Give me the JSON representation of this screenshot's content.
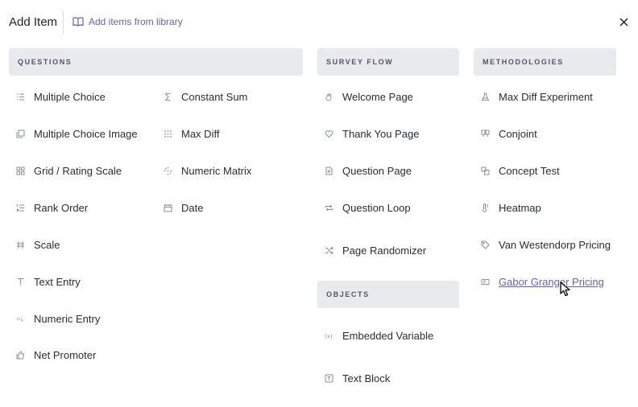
{
  "header": {
    "title": "Add Item",
    "library_link": "Add items from library"
  },
  "sections": {
    "questions": {
      "heading": "QUESTIONS",
      "col1": [
        {
          "label": "Multiple Choice",
          "icon": "list-icon"
        },
        {
          "label": "Multiple Choice Image",
          "icon": "image-stack-icon"
        },
        {
          "label": "Grid / Rating Scale",
          "icon": "grid-icon"
        },
        {
          "label": "Rank Order",
          "icon": "ordered-list-icon"
        },
        {
          "label": "Scale",
          "icon": "scale-icon"
        },
        {
          "label": "Text Entry",
          "icon": "text-icon"
        },
        {
          "label": "Numeric Entry",
          "icon": "numbers-icon"
        },
        {
          "label": "Net Promoter",
          "icon": "thumbs-up-icon"
        }
      ],
      "col2": [
        {
          "label": "Constant Sum",
          "icon": "sigma-icon"
        },
        {
          "label": "Max Diff",
          "icon": "dots-grid-icon"
        },
        {
          "label": "Numeric Matrix",
          "icon": "dots-circle-icon"
        },
        {
          "label": "Date",
          "icon": "calendar-icon"
        }
      ]
    },
    "survey_flow": {
      "heading": "SURVEY FLOW",
      "items": [
        {
          "label": "Welcome Page",
          "icon": "hand-icon"
        },
        {
          "label": "Thank You Page",
          "icon": "heart-icon"
        },
        {
          "label": "Question Page",
          "icon": "page-icon"
        },
        {
          "label": "Question Loop",
          "icon": "loop-icon"
        },
        {
          "label": "Page Randomizer",
          "icon": "shuffle-icon"
        }
      ]
    },
    "objects": {
      "heading": "OBJECTS",
      "items": [
        {
          "label": "Embedded Variable",
          "icon": "variable-icon"
        },
        {
          "label": "Text Block",
          "icon": "text-block-icon"
        }
      ]
    },
    "methodologies": {
      "heading": "METHODOLOGIES",
      "items": [
        {
          "label": "Max Diff Experiment",
          "icon": "flask-icon"
        },
        {
          "label": "Conjoint",
          "icon": "conjoint-icon"
        },
        {
          "label": "Concept Test",
          "icon": "concept-icon"
        },
        {
          "label": "Heatmap",
          "icon": "thermometer-icon"
        },
        {
          "label": "Van Westendorp Pricing",
          "icon": "tag-icon"
        },
        {
          "label": "Gabor Granger Pricing",
          "icon": "ticket-icon"
        }
      ]
    }
  },
  "colors": {
    "accent": "#6b5fb5",
    "section_bg": "#e9eaee",
    "icon": "#8a8f9c"
  }
}
